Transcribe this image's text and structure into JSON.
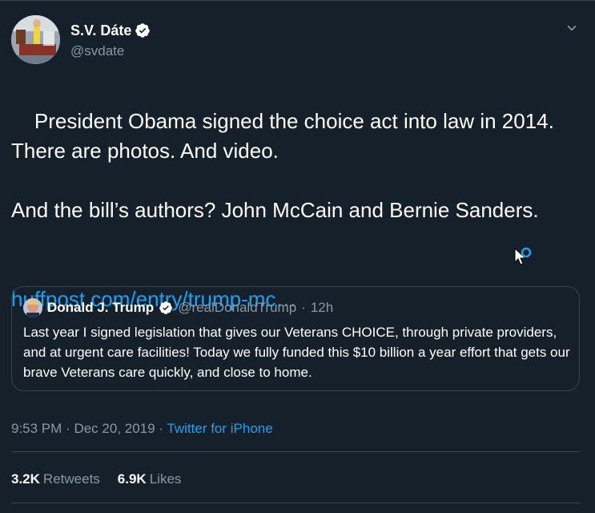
{
  "author": {
    "display_name": "S.V. Dáte",
    "handle": "@svdate",
    "avatar_icon": "user-photo",
    "verified_icon": "verified-badge-icon"
  },
  "tweet": {
    "text": "President Obama signed the choice act into law in 2014. There are photos. And video.\n\nAnd the bill’s authors? John McCain and Bernie Sanders.",
    "link_text": "huffpost.com/entry/trump-mc…"
  },
  "quote": {
    "display_name": "Donald J. Trump",
    "handle": "@realDonaldTrump",
    "separator": "·",
    "time": "12h",
    "text": "Last year I signed legislation that gives our Veterans CHOICE, through private providers, and at urgent care facilities! Today we fully funded this $10 billion a year effort that gets our brave Veterans care quickly, and close to home."
  },
  "meta": {
    "time": "9:53 PM",
    "sep1": "·",
    "date": "Dec 20, 2019",
    "sep2": "·",
    "source": "Twitter for iPhone"
  },
  "stats": {
    "retweets_count": "3.2K",
    "retweets_label": "Retweets",
    "likes_count": "6.9K",
    "likes_label": "Likes"
  },
  "colors": {
    "background": "#15202b",
    "accent": "#1da1f2",
    "muted": "#8899a6",
    "border": "#38444d"
  }
}
